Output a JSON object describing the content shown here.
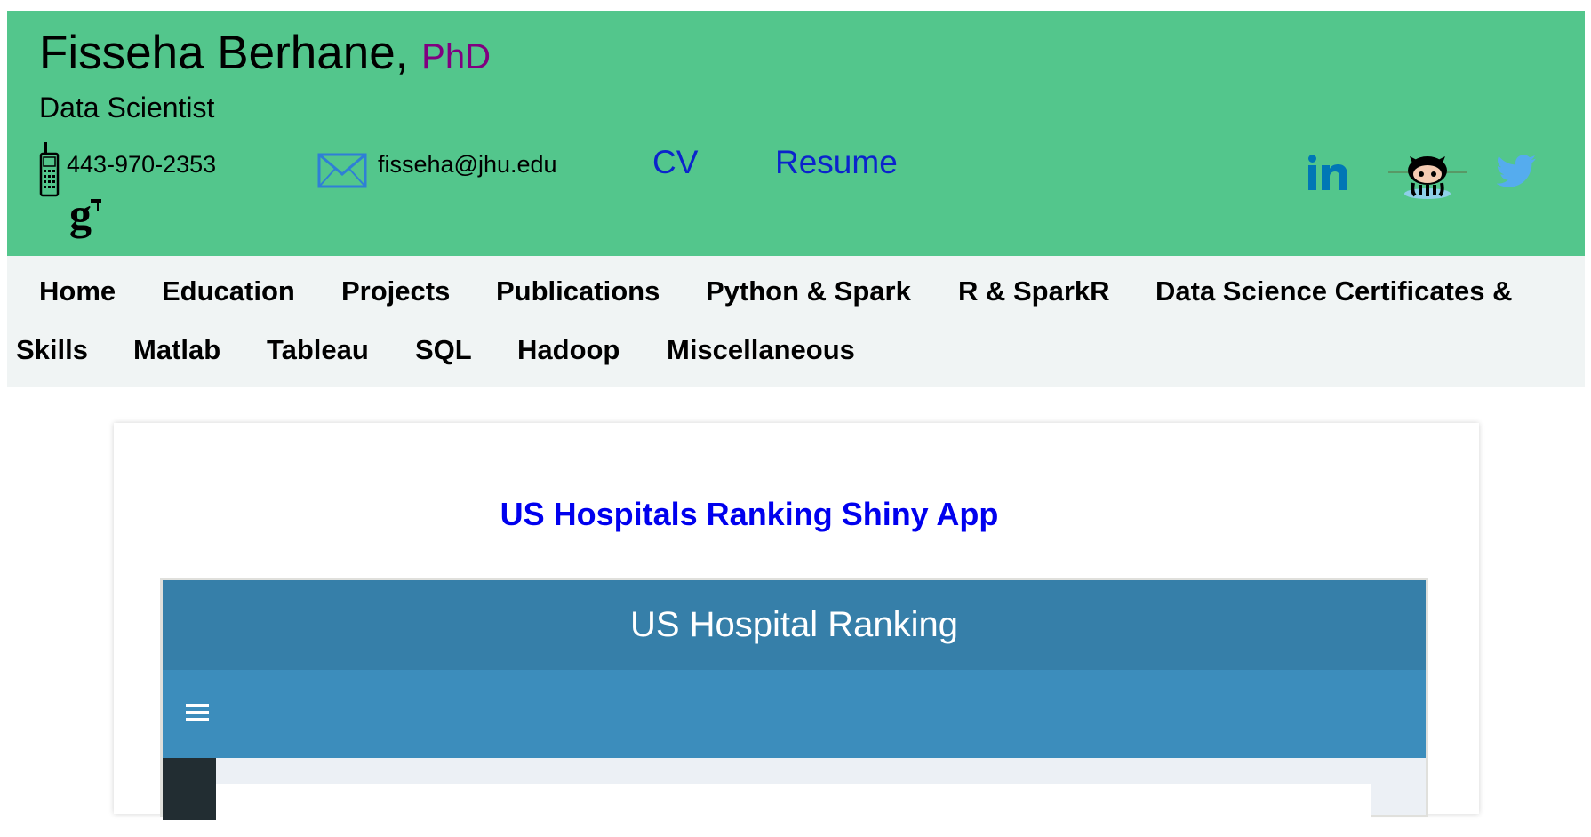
{
  "header": {
    "name": "Fisseha Berhane,",
    "degree": "PhD",
    "title": "Data Scientist",
    "phone": "443-970-2353",
    "email": "fisseha@jhu.edu",
    "cv_label": "CV",
    "resume_label": "Resume",
    "icons": [
      "phone-icon",
      "mail-icon",
      "google-scholar-icon",
      "linkedin-icon",
      "github-icon",
      "twitter-icon"
    ]
  },
  "nav": {
    "items": [
      "Home",
      "Education",
      "Projects",
      "Publications",
      "Python & Spark",
      "R & SparkR",
      "Data Science Certificates &",
      "Skills",
      "Matlab",
      "Tableau",
      "SQL",
      "Hadoop",
      "Miscellaneous"
    ]
  },
  "main": {
    "title": "US Hospitals Ranking Shiny App",
    "app": {
      "header_title": "US Hospital Ranking",
      "menu_icon": "hamburger-menu-icon"
    }
  },
  "colors": {
    "header_bg": "#53c68c",
    "nav_bg": "#f0f4f4",
    "degree": "#800080",
    "link": "#0b24cc",
    "title_link": "#0000ee",
    "app_header": "#367fa9",
    "app_navbar": "#3c8dbc",
    "app_sidebar": "#222d32",
    "linkedin": "#0077b5",
    "twitter": "#55acee"
  }
}
